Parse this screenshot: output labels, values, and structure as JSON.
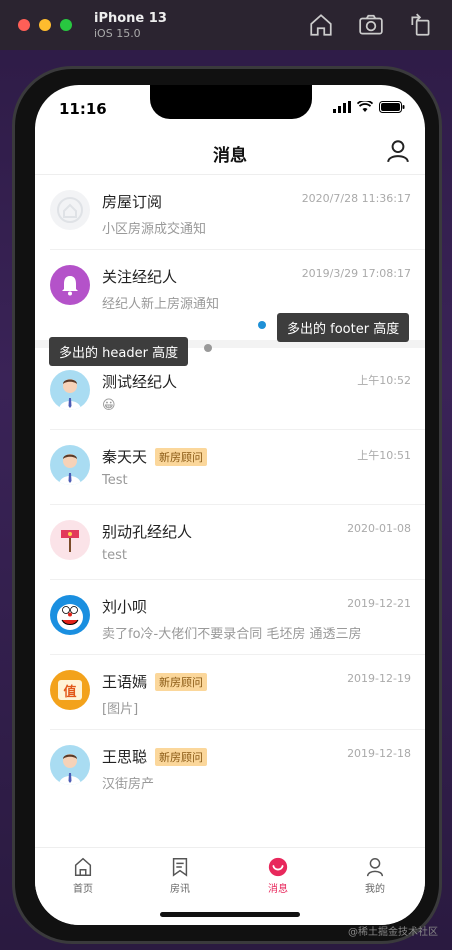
{
  "simulator": {
    "device": "iPhone 13",
    "os": "iOS 15.0"
  },
  "status": {
    "time": "11:16"
  },
  "nav": {
    "title": "消息"
  },
  "pinned": [
    {
      "name": "房屋订阅",
      "subtitle": "小区房源成交通知",
      "time": "2020/7/28 11:36:17",
      "icon": "house-subscribe-icon"
    },
    {
      "name": "关注经纪人",
      "subtitle": "经纪人新上房源通知",
      "time": "2019/3/29 17:08:17",
      "icon": "bell-icon"
    }
  ],
  "tooltips": {
    "footer": "多出的 footer 高度",
    "header": "多出的 header 高度"
  },
  "chats": [
    {
      "name": "测试经纪人",
      "tag": "",
      "subtitle": "😀",
      "time": "上午10:52"
    },
    {
      "name": "秦天天",
      "tag": "新房顾问",
      "subtitle": "Test",
      "time": "上午10:51"
    },
    {
      "name": "别动孔经纪人",
      "tag": "",
      "subtitle": "test",
      "time": "2020-01-08"
    },
    {
      "name": "刘小呗",
      "tag": "",
      "subtitle": "卖了fo冷-大佬们不要录合同 毛坯房 通透三房",
      "time": "2019-12-21"
    },
    {
      "name": "王语嫣",
      "tag": "新房顾问",
      "subtitle": "[图片]",
      "time": "2019-12-19"
    },
    {
      "name": "王思聪",
      "tag": "新房顾问",
      "subtitle": "汉街房产",
      "time": "2019-12-18"
    }
  ],
  "tabs": [
    {
      "label": "首页",
      "icon": "home-icon"
    },
    {
      "label": "房讯",
      "icon": "bookmark-icon"
    },
    {
      "label": "消息",
      "icon": "message-icon"
    },
    {
      "label": "我的",
      "icon": "profile-icon"
    }
  ],
  "watermark": "@稀土掘金技术社区",
  "colors": {
    "accent": "#e8285c",
    "tag_bg": "#fbd79b",
    "tooltip_bg": "#3d3d3d",
    "dot_blue": "#1e90d6"
  }
}
